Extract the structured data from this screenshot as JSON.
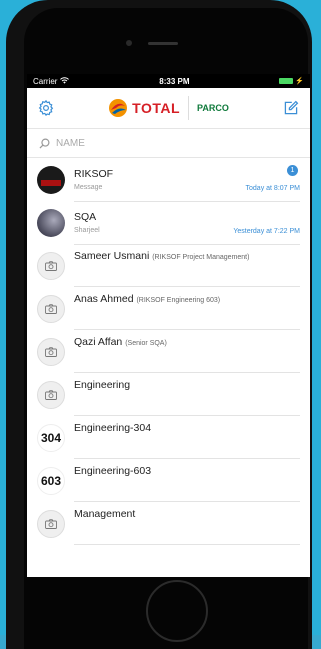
{
  "status": {
    "carrier": "Carrier",
    "time": "8:33 PM"
  },
  "header": {
    "brand1": "TOTAL",
    "brand2": "PARCO"
  },
  "search": {
    "placeholder": "NAME"
  },
  "chats": [
    {
      "name": "RIKSOF",
      "sub": "Message",
      "time": "Today at 8:07 PM",
      "badge": "1",
      "avatar": "dark"
    },
    {
      "name": "SQA",
      "sub": "Sharjeel",
      "time": "Yesterday at 7:22 PM",
      "badge": "",
      "avatar": "photo"
    },
    {
      "name": "Sameer Usmani",
      "role": "(RIKSOF Project Management)",
      "avatar": "cam"
    },
    {
      "name": "Anas Ahmed",
      "role": "(RIKSOF Engineering 603)",
      "avatar": "cam"
    },
    {
      "name": "Qazi Affan",
      "role": "(Senior SQA)",
      "avatar": "cam"
    },
    {
      "name": "Engineering",
      "role": "",
      "avatar": "cam"
    },
    {
      "name": "Engineering-304",
      "role": "",
      "avatar": "num",
      "avatar_text": "304"
    },
    {
      "name": "Engineering-603",
      "role": "",
      "avatar": "num",
      "avatar_text": "603"
    },
    {
      "name": "Management",
      "role": "",
      "avatar": "cam"
    }
  ],
  "colors": {
    "accent": "#3b8fd6",
    "total_red": "#d61f26",
    "parco_green": "#0f7a3b"
  }
}
